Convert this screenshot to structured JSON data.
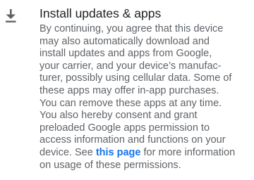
{
  "item": {
    "icon": "download-icon",
    "title": "Install updates & apps",
    "lines": [
      "By continuing, you agree that this device",
      "may also automatically download and",
      "install updates and apps from Google,",
      "your carrier, and your device’s manufac-",
      "turer, possibly using cellular data. Some of",
      "these apps may offer in-app purchases.",
      "You can remove these apps at any time.",
      "You also hereby consent and grant",
      "preloaded Google apps permission to",
      "access information and functions on your"
    ],
    "line11_before": "device. See ",
    "link_text": "this page",
    "line11_after": " for more information",
    "line12": "on usage of these permissions."
  },
  "colors": {
    "title": "#202124",
    "body": "#5f6368",
    "icon": "#5f6368",
    "link": "#1a73e8"
  }
}
